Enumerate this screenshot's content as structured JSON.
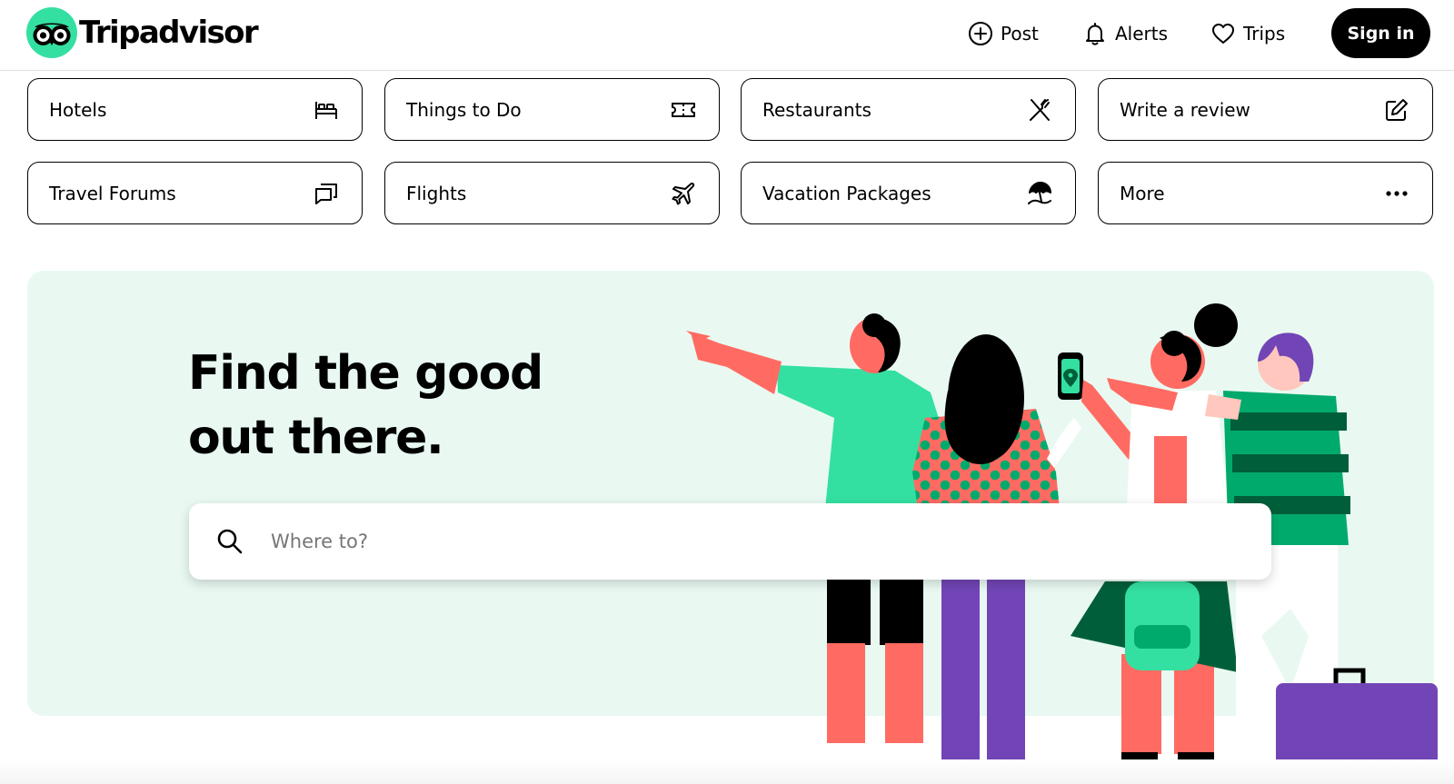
{
  "header": {
    "logo_text": "Tripadvisor",
    "nav": {
      "post_label": "Post",
      "alerts_label": "Alerts",
      "trips_label": "Trips",
      "signin_label": "Sign in"
    }
  },
  "categories": [
    {
      "label": "Hotels",
      "icon": "bed-icon"
    },
    {
      "label": "Things to Do",
      "icon": "ticket-icon"
    },
    {
      "label": "Restaurants",
      "icon": "utensils-icon"
    },
    {
      "label": "Write a review",
      "icon": "edit-icon"
    },
    {
      "label": "Travel Forums",
      "icon": "chat-icon"
    },
    {
      "label": "Flights",
      "icon": "plane-icon"
    },
    {
      "label": "Vacation Packages",
      "icon": "beach-umbrella-icon"
    },
    {
      "label": "More",
      "icon": "ellipsis-icon"
    }
  ],
  "hero": {
    "title": "Find the good out there.",
    "search_placeholder": "Where to?"
  },
  "colors": {
    "brand_green": "#34e0a1",
    "hero_background": "#e9f9f2",
    "button_black": "#000000",
    "coral": "#ff6b62",
    "dark_green": "#005f3a",
    "purple": "#7245b6"
  }
}
